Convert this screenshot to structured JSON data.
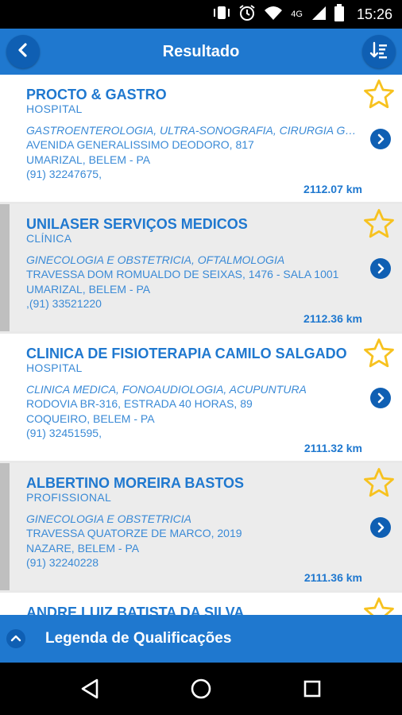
{
  "status_bar": {
    "time": "15:26",
    "network": "4G",
    "icons": [
      "vibrate-icon",
      "alarm-icon",
      "wifi-icon",
      "signal-icon",
      "battery-icon"
    ]
  },
  "app_bar": {
    "title": "Resultado",
    "back_icon": "chevron-left-icon",
    "sort_icon": "sort-icon"
  },
  "results": [
    {
      "name": "PROCTO & GASTRO",
      "type": "HOSPITAL",
      "specialties": "GASTROENTEROLOGIA, ULTRA-SONOGRAFIA, CIRURGIA GERAL",
      "address": "AVENIDA GENERALISSIMO DEODORO, 817",
      "city": "UMARIZAL, BELEM - PA",
      "phone": "(91) 32247675,",
      "distance": "2112.07 km"
    },
    {
      "name": "UNILASER SERVIÇOS MEDICOS",
      "type": "CLÍNICA",
      "specialties": "GINECOLOGIA E OBSTETRICIA, OFTALMOLOGIA",
      "address": "TRAVESSA DOM ROMUALDO DE SEIXAS, 1476 - SALA 1001",
      "city": "UMARIZAL, BELEM - PA",
      "phone": ",(91) 33521220",
      "distance": "2112.36 km"
    },
    {
      "name": "CLINICA DE FISIOTERAPIA CAMILO SALGADO",
      "type": "HOSPITAL",
      "specialties": "CLINICA MEDICA, FONOAUDIOLOGIA, ACUPUNTURA",
      "address": "RODOVIA BR-316, ESTRADA 40 HORAS, 89",
      "city": "COQUEIRO, BELEM - PA",
      "phone": "(91) 32451595,",
      "distance": "2111.32 km"
    },
    {
      "name": "ALBERTINO MOREIRA BASTOS",
      "type": "PROFISSIONAL",
      "specialties": "GINECOLOGIA E OBSTETRICIA",
      "address": "TRAVESSA QUATORZE DE MARCO, 2019",
      "city": "NAZARE, BELEM - PA",
      "phone": "(91) 32240228",
      "distance": "2111.36 km"
    },
    {
      "name": "ANDRE LUIZ BATISTA DA SILVA",
      "type": "",
      "specialties": "",
      "address": "",
      "city": "",
      "phone": "",
      "distance": ""
    }
  ],
  "legend": {
    "label": "Legenda de Qualificações",
    "icon": "chevron-up-icon"
  },
  "nav_bar": {
    "icons": [
      "back-triangle-icon",
      "home-circle-icon",
      "recents-square-icon"
    ]
  },
  "colors": {
    "accent": "#1f78cf",
    "accent_dark": "#0f5fb3",
    "text": "#3a8ad6",
    "star": "#f7c21f"
  }
}
